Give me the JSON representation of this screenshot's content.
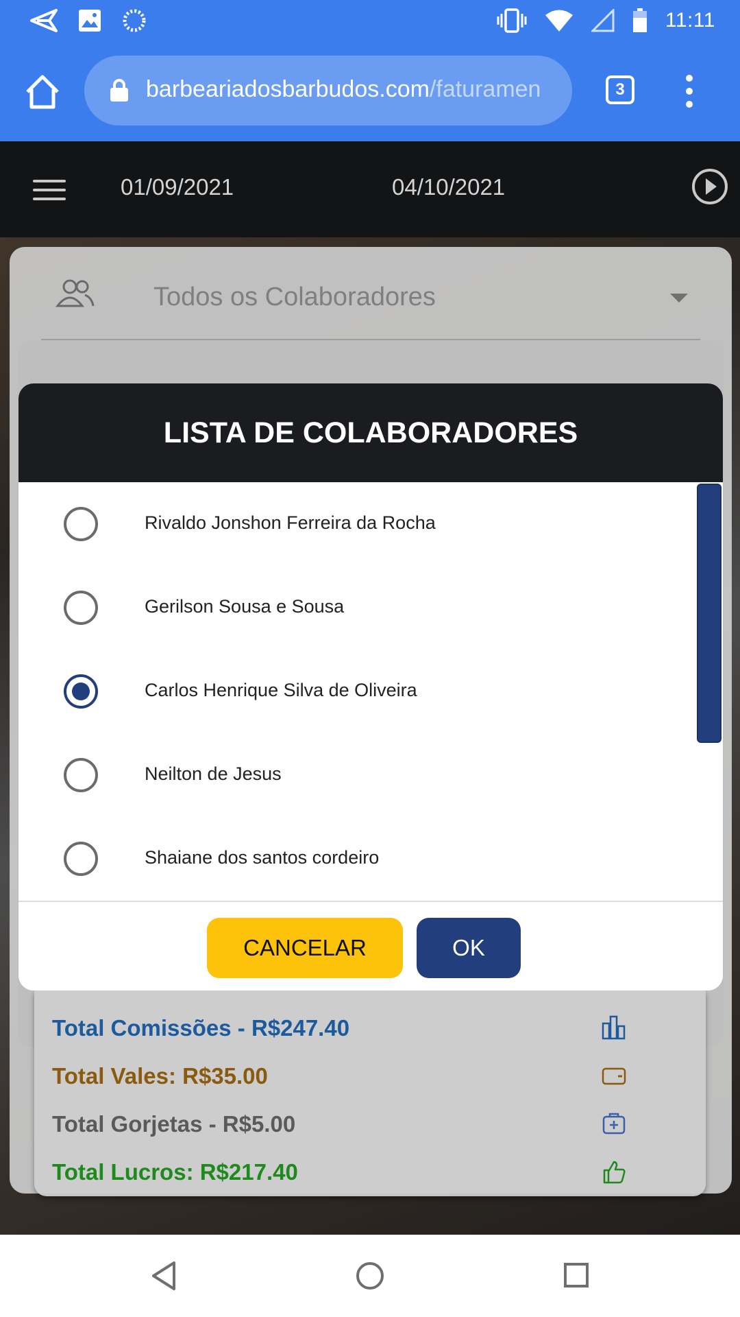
{
  "status_bar": {
    "time": "11:11",
    "left_icons": [
      "send-icon",
      "image-icon",
      "loading-icon"
    ],
    "right_icons": [
      "vibrate-icon",
      "wifi-icon",
      "signal-icon",
      "battery-icon"
    ]
  },
  "browser": {
    "url_domain": "barbeariadosbarbudos.com",
    "url_path": "/faturamen",
    "tab_count": "3"
  },
  "app_bar": {
    "start_date": "01/09/2021",
    "end_date": "04/10/2021"
  },
  "filter": {
    "collaborator_placeholder": "Todos os Colaboradores"
  },
  "dialog": {
    "title": "LISTA DE COLABORADORES",
    "options": [
      {
        "label": "Rivaldo Jonshon Ferreira da Rocha",
        "selected": false
      },
      {
        "label": "Gerilson Sousa e Sousa",
        "selected": false
      },
      {
        "label": "Carlos Henrique Silva de Oliveira",
        "selected": true
      },
      {
        "label": "Neilton de Jesus",
        "selected": false
      },
      {
        "label": "Shaiane dos santos cordeiro",
        "selected": false
      }
    ],
    "cancel_label": "CANCELAR",
    "ok_label": "OK"
  },
  "totals": {
    "comissoes": "Total Comissões - R$247.40",
    "vales": "Total Vales: R$35.00",
    "gorjetas": "Total Gorjetas - R$5.00",
    "lucros": "Total Lucros: R$217.40"
  },
  "colors": {
    "browser_blue": "#3b7ded",
    "dialog_primary": "#223e7c",
    "cancel_yellow": "#fdc30a",
    "comissoes": "#1c5a9e",
    "vales": "#8a5a0e",
    "gorjetas": "#5a5a5a",
    "lucros": "#1e8a1e"
  }
}
